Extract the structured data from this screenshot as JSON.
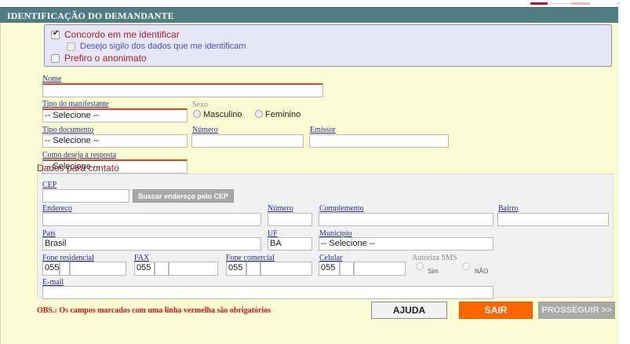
{
  "section_header": "IDENTIFICAÇÃO DO DEMANDANTE",
  "identification": {
    "agree_label": "Concordo em me identificar",
    "agree_checked": true,
    "secrecy_label": "Desejo sigilo dos dados que me identificam",
    "secrecy_checked": false,
    "anonymous_label": "Prefiro o anonimato",
    "anonymous_checked": false
  },
  "fields": {
    "nome_label": "Nome",
    "nome_value": "",
    "tipo_manifestante_label": "Tipo do manifestante",
    "tipo_manifestante_value": "-- Selecione --",
    "sexo_label": "Sexo",
    "sexo_options": [
      "Masculino",
      "Feminino"
    ],
    "tipo_documento_label": "Tipo documento",
    "tipo_documento_value": "-- Selecione --",
    "numero_label": "Número",
    "numero_value": "",
    "emissor_label": "Emissor",
    "emissor_value": "",
    "resposta_label": "Como deseja a resposta",
    "resposta_value": "-- Selecione --"
  },
  "contact": {
    "title": "Dados para contato",
    "cep_label": "CEP",
    "cep_value": "",
    "cep_button": "Buscar endereço pelo CEP",
    "endereco_label": "Endereço",
    "numero_label": "Número",
    "complemento_label": "Complemento",
    "bairro_label": "Bairro",
    "pais_label": "País",
    "pais_value": "Brasil",
    "uf_label": "UF",
    "uf_value": "BA",
    "municipio_label": "Município",
    "municipio_value": "-- Selecione --",
    "fone_residencial_label": "Fone residencial",
    "fone_residencial_ddi": "055",
    "fax_label": "FAX",
    "fax_ddi": "055",
    "fone_comercial_label": "Fone comercial",
    "fone_comercial_ddi": "055",
    "celular_label": "Celular",
    "celular_ddi": "055",
    "sms_label": "Autoriza SMS",
    "sms_options": [
      "Sim",
      "NÃO"
    ],
    "email_label": "E-mail"
  },
  "obs_text": "OBS.: Os campos marcados com uma linha vermelha são obrigatórios",
  "buttons": {
    "ajuda": "AJUDA",
    "sair": "SAIR",
    "prosseguir": "PROSSEGUIR >>"
  },
  "colors": {
    "header_bg": "#4f7d82",
    "form_bg": "#fcfcd4",
    "sair_bg": "#ff6600"
  }
}
